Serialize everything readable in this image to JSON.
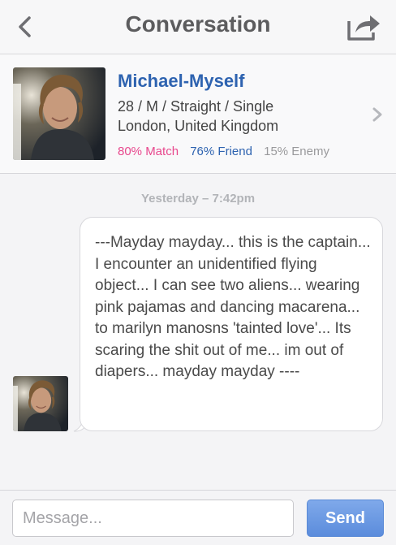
{
  "header": {
    "title": "Conversation",
    "back_icon": "chevron-left-icon",
    "share_icon": "share-icon"
  },
  "profile": {
    "name": "Michael-Myself",
    "details": "28 / M / Straight / Single",
    "location": "London, United Kingdom",
    "match": "80% Match",
    "friend": "76% Friend",
    "enemy": "15% Enemy",
    "chevron_icon": "chevron-right-icon"
  },
  "conversation": {
    "timestamp": "Yesterday – 7:42pm",
    "message": "---Mayday mayday... this is the captain... I encounter an unidentified flying object... I can see two aliens... wearing pink pajamas and dancing macarena... to marilyn manosns 'tainted love'... Its scaring the shit out of me... im out of diapers... mayday mayday ----"
  },
  "composer": {
    "placeholder": "Message...",
    "send_label": "Send"
  },
  "colors": {
    "name": "#2e63b0",
    "match": "#e8488d",
    "friend": "#2e63b0",
    "enemy": "#9a9a9c",
    "send": "#5b8cdc"
  }
}
